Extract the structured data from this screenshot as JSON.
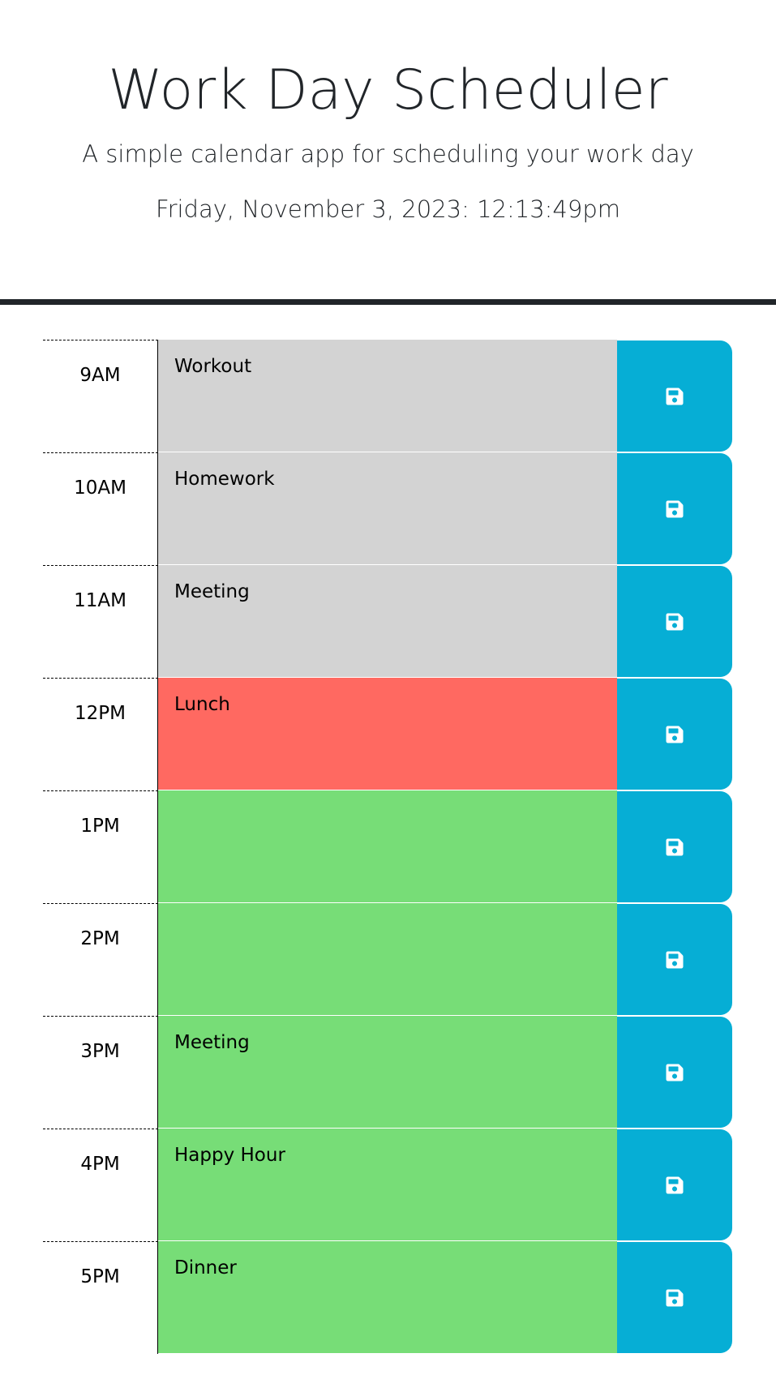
{
  "header": {
    "title": "Work Day Scheduler",
    "subtitle": "A simple calendar app for scheduling your work day",
    "current_day": "Friday, November 3, 2023: 12:13:49pm"
  },
  "colors": {
    "past": "#d3d3d3",
    "present": "#ff6961",
    "future": "#77dd77",
    "save_button": "#06aed5"
  },
  "time_blocks": [
    {
      "hour": "9AM",
      "text": "Workout",
      "status": "past",
      "icon": "save-icon"
    },
    {
      "hour": "10AM",
      "text": "Homework",
      "status": "past",
      "icon": "save-icon"
    },
    {
      "hour": "11AM",
      "text": "Meeting",
      "status": "past",
      "icon": "save-icon"
    },
    {
      "hour": "12PM",
      "text": "Lunch",
      "status": "present",
      "icon": "save-icon"
    },
    {
      "hour": "1PM",
      "text": "",
      "status": "future",
      "icon": "save-icon"
    },
    {
      "hour": "2PM",
      "text": "",
      "status": "future",
      "icon": "save-icon"
    },
    {
      "hour": "3PM",
      "text": "Meeting",
      "status": "future",
      "icon": "save-icon"
    },
    {
      "hour": "4PM",
      "text": "Happy Hour",
      "status": "future",
      "icon": "save-icon"
    },
    {
      "hour": "5PM",
      "text": "Dinner",
      "status": "future",
      "icon": "save-icon"
    }
  ]
}
